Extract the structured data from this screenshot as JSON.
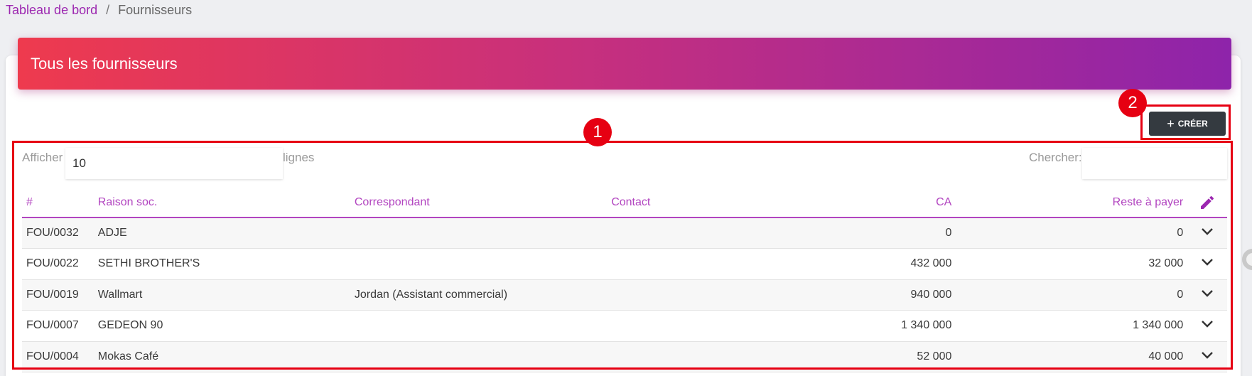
{
  "breadcrumb": {
    "home": "Tableau de bord",
    "separator": "/",
    "current": "Fournisseurs"
  },
  "card": {
    "title": "Tous les fournisseurs"
  },
  "create_button": {
    "icon": "+",
    "label": "CRÉER"
  },
  "annotations": {
    "label_1": "1",
    "label_2": "2",
    "color": "#e60012"
  },
  "controls": {
    "show_label": "Afficher",
    "page_length": "10",
    "rows_label": "lignes",
    "search_label": "Chercher:",
    "search_value": ""
  },
  "table": {
    "headers": [
      "#",
      "Raison soc.",
      "Correspondant",
      "Contact",
      "CA",
      "Reste à payer"
    ],
    "action_icon": "pencil-icon",
    "rows": [
      {
        "id": "FOU/0032",
        "name": "ADJE",
        "correspondent": "",
        "contact": "",
        "ca": "0",
        "due": "0"
      },
      {
        "id": "FOU/0022",
        "name": "SETHI BROTHER'S",
        "correspondent": "",
        "contact": "",
        "ca": "432 000",
        "due": "32 000"
      },
      {
        "id": "FOU/0019",
        "name": "Wallmart",
        "correspondent": "Jordan (Assistant commercial)",
        "contact": "",
        "ca": "940 000",
        "due": "0"
      },
      {
        "id": "FOU/0007",
        "name": "GEDEON 90",
        "correspondent": "",
        "contact": "",
        "ca": "1 340 000",
        "due": "1 340 000"
      },
      {
        "id": "FOU/0004",
        "name": "Mokas Café",
        "correspondent": "",
        "contact": "",
        "ca": "52 000",
        "due": "40 000"
      }
    ]
  },
  "colors": {
    "accent": "#9c27b0",
    "header_gradient_start": "#ee3a4e",
    "header_gradient_end": "#8e24aa",
    "button": "#343a40"
  }
}
